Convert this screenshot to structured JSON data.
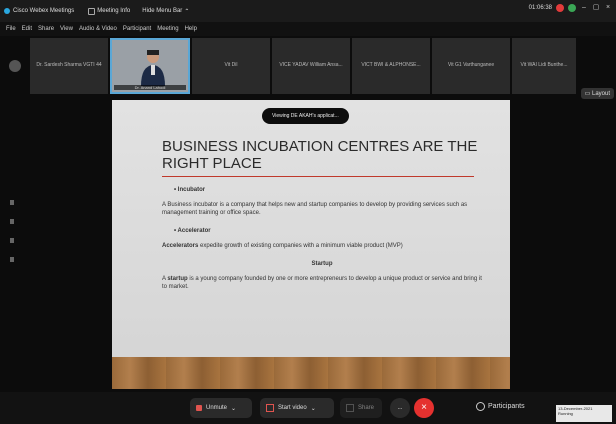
{
  "window": {
    "title": "Cisco Webex Meetings",
    "meeting_info": "Meeting Info",
    "hide_menu": "Hide Menu Bar",
    "timer": "01:06:38"
  },
  "menu": [
    "File",
    "Edit",
    "Share",
    "View",
    "Audio & Video",
    "Participant",
    "Meeting",
    "Help"
  ],
  "participants_strip": [
    {
      "name": "Dr. Sardesh Sharma VGTI 44",
      "active": false
    },
    {
      "name": "Dr. Anand Lahodi",
      "active": true
    },
    {
      "name": "Vit Dil",
      "active": false
    },
    {
      "name": "VICE YADAV William Ansa...",
      "active": false
    },
    {
      "name": "VICT BWI & ALPHONSE...",
      "active": false
    },
    {
      "name": "Vit G1 Varthunganee",
      "active": false
    },
    {
      "name": "Vit WAI Lidi Bunthe...",
      "active": false
    }
  ],
  "layout_button": "Layout",
  "share_banner": "Viewing DE AKAH's applicat...",
  "slide": {
    "title": "Business Incubation Centres are the right place",
    "h1": "Incubator",
    "p1": "A Business incubator is a company that helps new and startup companies to develop by providing services such as management training or office space.",
    "h2": "Accelerator",
    "p2_bold": "Accelerators",
    "p2": " expedite growth of existing companies with a minimum viable product (MVP)",
    "h3": "Startup",
    "p3_pre": "A ",
    "p3_bold": "startup",
    "p3": " is a young company founded by one or more entrepreneurs to develop a unique product or service and bring it to market."
  },
  "controls": {
    "unmute": "Unmute",
    "start_video": "Start video",
    "share": "Share",
    "more": "...",
    "end": "×",
    "participants": "Participants"
  },
  "taskbar": {
    "date": "13-December-2021",
    "note": "Running"
  },
  "colors": {
    "end_call": "#e5312f",
    "accent": "#5aa7d6",
    "slide_rule": "#c0392b"
  }
}
